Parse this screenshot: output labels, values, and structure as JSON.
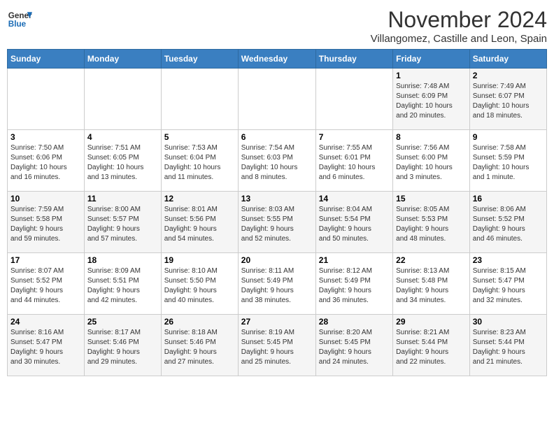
{
  "header": {
    "logo_line1": "General",
    "logo_line2": "Blue",
    "month": "November 2024",
    "location": "Villangomez, Castille and Leon, Spain"
  },
  "days_of_week": [
    "Sunday",
    "Monday",
    "Tuesday",
    "Wednesday",
    "Thursday",
    "Friday",
    "Saturday"
  ],
  "weeks": [
    [
      {
        "day": "",
        "info": ""
      },
      {
        "day": "",
        "info": ""
      },
      {
        "day": "",
        "info": ""
      },
      {
        "day": "",
        "info": ""
      },
      {
        "day": "",
        "info": ""
      },
      {
        "day": "1",
        "info": "Sunrise: 7:48 AM\nSunset: 6:09 PM\nDaylight: 10 hours\nand 20 minutes."
      },
      {
        "day": "2",
        "info": "Sunrise: 7:49 AM\nSunset: 6:07 PM\nDaylight: 10 hours\nand 18 minutes."
      }
    ],
    [
      {
        "day": "3",
        "info": "Sunrise: 7:50 AM\nSunset: 6:06 PM\nDaylight: 10 hours\nand 16 minutes."
      },
      {
        "day": "4",
        "info": "Sunrise: 7:51 AM\nSunset: 6:05 PM\nDaylight: 10 hours\nand 13 minutes."
      },
      {
        "day": "5",
        "info": "Sunrise: 7:53 AM\nSunset: 6:04 PM\nDaylight: 10 hours\nand 11 minutes."
      },
      {
        "day": "6",
        "info": "Sunrise: 7:54 AM\nSunset: 6:03 PM\nDaylight: 10 hours\nand 8 minutes."
      },
      {
        "day": "7",
        "info": "Sunrise: 7:55 AM\nSunset: 6:01 PM\nDaylight: 10 hours\nand 6 minutes."
      },
      {
        "day": "8",
        "info": "Sunrise: 7:56 AM\nSunset: 6:00 PM\nDaylight: 10 hours\nand 3 minutes."
      },
      {
        "day": "9",
        "info": "Sunrise: 7:58 AM\nSunset: 5:59 PM\nDaylight: 10 hours\nand 1 minute."
      }
    ],
    [
      {
        "day": "10",
        "info": "Sunrise: 7:59 AM\nSunset: 5:58 PM\nDaylight: 9 hours\nand 59 minutes."
      },
      {
        "day": "11",
        "info": "Sunrise: 8:00 AM\nSunset: 5:57 PM\nDaylight: 9 hours\nand 57 minutes."
      },
      {
        "day": "12",
        "info": "Sunrise: 8:01 AM\nSunset: 5:56 PM\nDaylight: 9 hours\nand 54 minutes."
      },
      {
        "day": "13",
        "info": "Sunrise: 8:03 AM\nSunset: 5:55 PM\nDaylight: 9 hours\nand 52 minutes."
      },
      {
        "day": "14",
        "info": "Sunrise: 8:04 AM\nSunset: 5:54 PM\nDaylight: 9 hours\nand 50 minutes."
      },
      {
        "day": "15",
        "info": "Sunrise: 8:05 AM\nSunset: 5:53 PM\nDaylight: 9 hours\nand 48 minutes."
      },
      {
        "day": "16",
        "info": "Sunrise: 8:06 AM\nSunset: 5:52 PM\nDaylight: 9 hours\nand 46 minutes."
      }
    ],
    [
      {
        "day": "17",
        "info": "Sunrise: 8:07 AM\nSunset: 5:52 PM\nDaylight: 9 hours\nand 44 minutes."
      },
      {
        "day": "18",
        "info": "Sunrise: 8:09 AM\nSunset: 5:51 PM\nDaylight: 9 hours\nand 42 minutes."
      },
      {
        "day": "19",
        "info": "Sunrise: 8:10 AM\nSunset: 5:50 PM\nDaylight: 9 hours\nand 40 minutes."
      },
      {
        "day": "20",
        "info": "Sunrise: 8:11 AM\nSunset: 5:49 PM\nDaylight: 9 hours\nand 38 minutes."
      },
      {
        "day": "21",
        "info": "Sunrise: 8:12 AM\nSunset: 5:49 PM\nDaylight: 9 hours\nand 36 minutes."
      },
      {
        "day": "22",
        "info": "Sunrise: 8:13 AM\nSunset: 5:48 PM\nDaylight: 9 hours\nand 34 minutes."
      },
      {
        "day": "23",
        "info": "Sunrise: 8:15 AM\nSunset: 5:47 PM\nDaylight: 9 hours\nand 32 minutes."
      }
    ],
    [
      {
        "day": "24",
        "info": "Sunrise: 8:16 AM\nSunset: 5:47 PM\nDaylight: 9 hours\nand 30 minutes."
      },
      {
        "day": "25",
        "info": "Sunrise: 8:17 AM\nSunset: 5:46 PM\nDaylight: 9 hours\nand 29 minutes."
      },
      {
        "day": "26",
        "info": "Sunrise: 8:18 AM\nSunset: 5:46 PM\nDaylight: 9 hours\nand 27 minutes."
      },
      {
        "day": "27",
        "info": "Sunrise: 8:19 AM\nSunset: 5:45 PM\nDaylight: 9 hours\nand 25 minutes."
      },
      {
        "day": "28",
        "info": "Sunrise: 8:20 AM\nSunset: 5:45 PM\nDaylight: 9 hours\nand 24 minutes."
      },
      {
        "day": "29",
        "info": "Sunrise: 8:21 AM\nSunset: 5:44 PM\nDaylight: 9 hours\nand 22 minutes."
      },
      {
        "day": "30",
        "info": "Sunrise: 8:23 AM\nSunset: 5:44 PM\nDaylight: 9 hours\nand 21 minutes."
      }
    ]
  ]
}
